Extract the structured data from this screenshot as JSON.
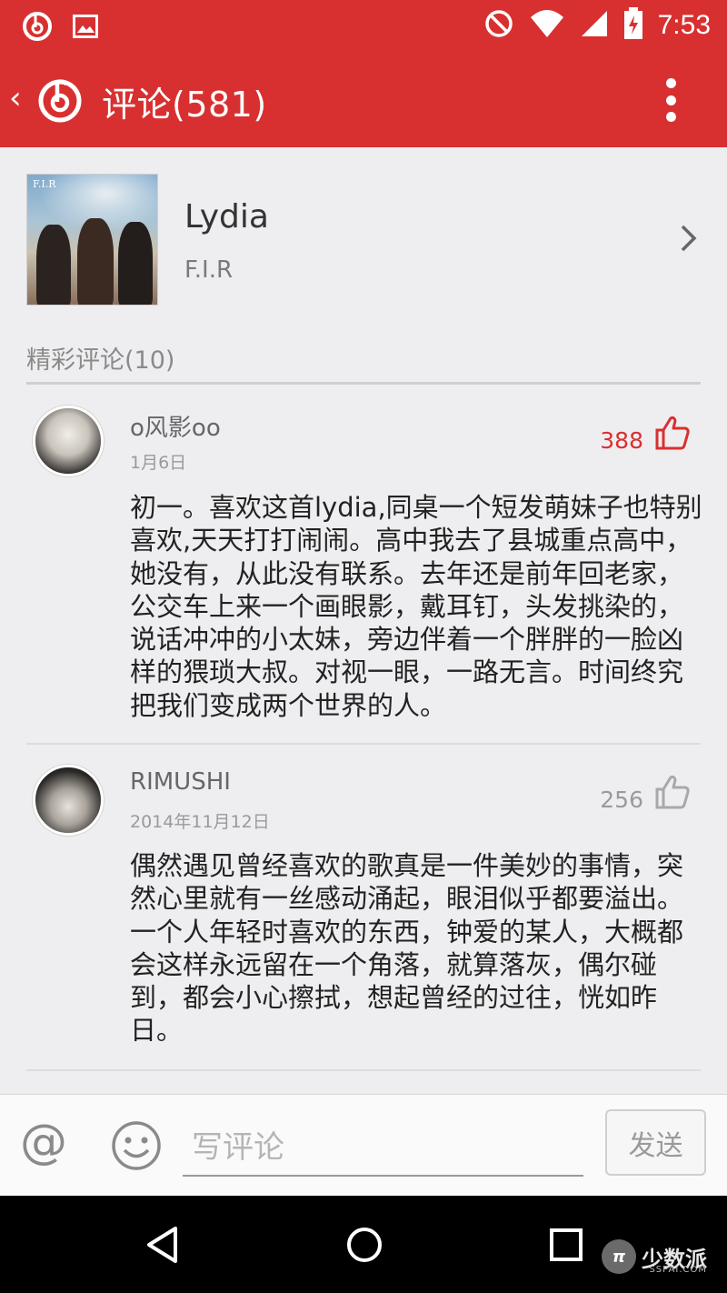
{
  "status_bar": {
    "time": "7:53"
  },
  "app_bar": {
    "back": "‹",
    "title": "评论(581)"
  },
  "song": {
    "title": "Lydia",
    "artist": "F.I.R",
    "art_tag": "F.I.R"
  },
  "section_label": "精彩评论(10)",
  "comments": [
    {
      "user": "o风影oo",
      "date": "1月6日",
      "likes": "388",
      "liked": true,
      "text": "初一。喜欢这首lydia,同桌一个短发萌妹子也特别喜欢,天天打打闹闹。高中我去了县城重点高中，她没有，从此没有联系。去年还是前年回老家，公交车上来一个画眼影，戴耳钉，头发挑染的，说话冲冲的小太妹，旁边伴着一个胖胖的一脸凶样的猥琐大叔。对视一眼，一路无言。时间终究把我们变成两个世界的人。"
    },
    {
      "user": "RIMUSHI",
      "date": "2014年11月12日",
      "likes": "256",
      "liked": false,
      "text": "偶然遇见曾经喜欢的歌真是一件美妙的事情，突然心里就有一丝感动涌起，眼泪似乎都要溢出。一个人年轻时喜欢的东西，钟爱的某人，大概都会这样永远留在一个角落，就算落灰，偶尔碰到，都会小心擦拭，想起曾经的过往，恍如昨日。"
    }
  ],
  "input_bar": {
    "at_label": "@",
    "placeholder": "写评论",
    "send_label": "发送"
  },
  "watermark": {
    "badge": "π",
    "text": "少数派",
    "sub": "SSPAI.COM"
  },
  "colors": {
    "brand_red": "#d83030",
    "liked_red": "#d83030",
    "muted": "#9a9a9a"
  },
  "icons": [
    "netease-music-icon",
    "image-icon",
    "dnd-icon",
    "wifi-icon",
    "signal-icon",
    "battery-icon",
    "more-vert-icon",
    "chevron-right-icon",
    "thumbs-up-icon",
    "emoji-icon",
    "nav-back-icon",
    "nav-home-icon",
    "nav-recent-icon"
  ]
}
